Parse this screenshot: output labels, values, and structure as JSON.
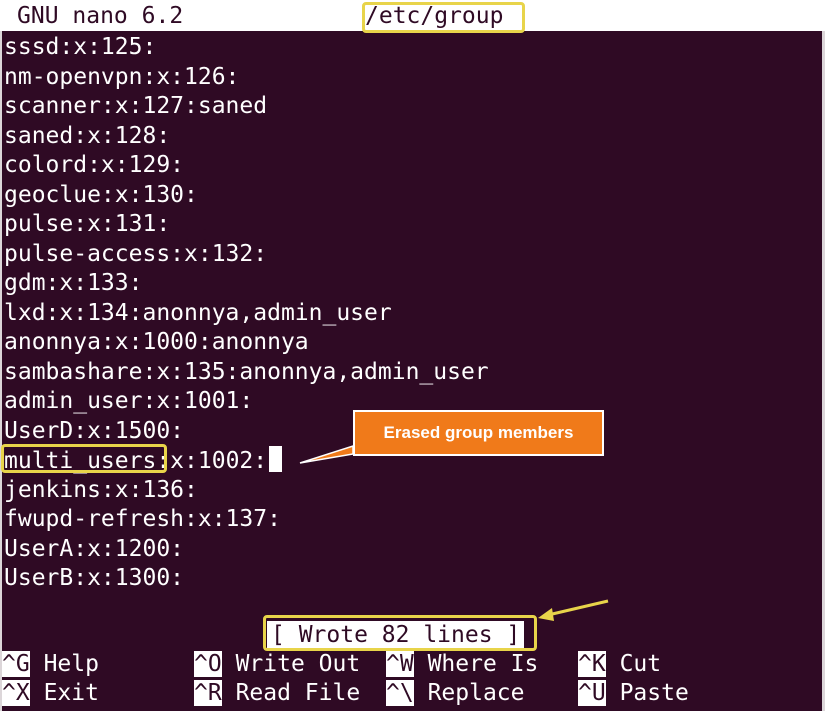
{
  "title_bar": {
    "app_name": "GNU nano 6.2",
    "file_name": "/etc/group"
  },
  "file_lines": [
    "sssd:x:125:",
    "nm-openvpn:x:126:",
    "scanner:x:127:saned",
    "saned:x:128:",
    "colord:x:129:",
    "geoclue:x:130:",
    "pulse:x:131:",
    "pulse-access:x:132:",
    "gdm:x:133:",
    "lxd:x:134:anonnya,admin_user",
    "anonnya:x:1000:anonnya",
    "sambashare:x:135:anonnya,admin_user",
    "admin_user:x:1001:",
    "UserD:x:1500:",
    "multi_users:x:1002:",
    "jenkins:x:136:",
    "fwupd-refresh:x:137:",
    "UserA:x:1200:",
    "UserB:x:1300:"
  ],
  "highlighted_line": {
    "group_name": "multi_users",
    "rest": ":x:1002:"
  },
  "callout": {
    "text": "Erased group members"
  },
  "status_message": "[ Wrote 82 lines ]",
  "shortcuts": [
    {
      "key": "^G",
      "label": "Help"
    },
    {
      "key": "^O",
      "label": "Write Out"
    },
    {
      "key": "^W",
      "label": "Where Is"
    },
    {
      "key": "^K",
      "label": "Cut"
    },
    {
      "key": "^X",
      "label": "Exit"
    },
    {
      "key": "^R",
      "label": "Read File"
    },
    {
      "key": "^\\",
      "label": "Replace"
    },
    {
      "key": "^U",
      "label": "Paste"
    }
  ],
  "colors": {
    "background": "#2f0a24",
    "highlight": "#e8d44a",
    "callout": "#f07a1a"
  }
}
